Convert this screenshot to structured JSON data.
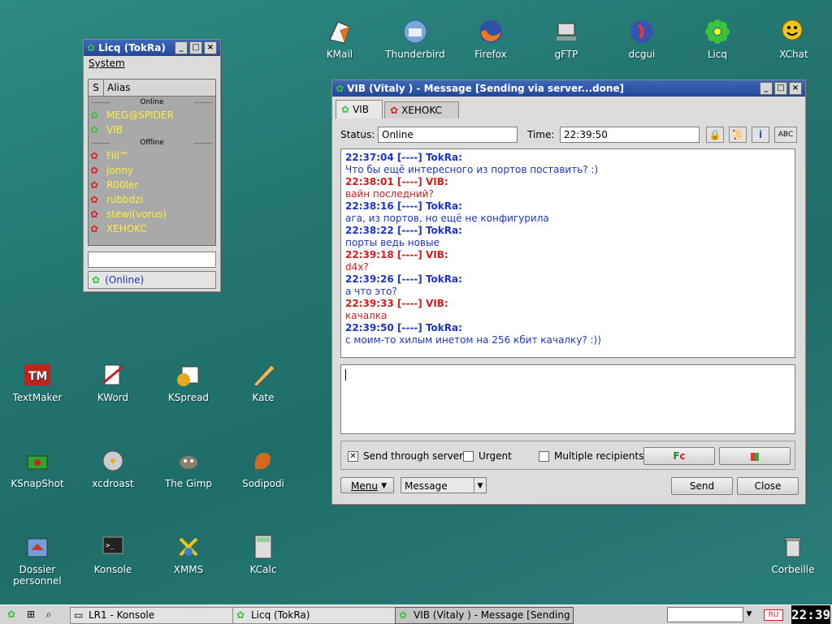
{
  "desktop_icons": [
    {
      "label": "KMail"
    },
    {
      "label": "Thunderbird"
    },
    {
      "label": "Firefox"
    },
    {
      "label": "gFTP"
    },
    {
      "label": "dcgui"
    },
    {
      "label": "Licq"
    },
    {
      "label": "XChat"
    },
    {
      "label": "TextMaker"
    },
    {
      "label": "KWord"
    },
    {
      "label": "KSpread"
    },
    {
      "label": "Kate"
    },
    {
      "label": "KSnapShot"
    },
    {
      "label": "xcdroast"
    },
    {
      "label": "The Gimp"
    },
    {
      "label": "Sodipodi"
    },
    {
      "label": "Dossier personnel"
    },
    {
      "label": "Konsole"
    },
    {
      "label": "XMMS"
    },
    {
      "label": "KCalc"
    },
    {
      "label": "Corbeille"
    }
  ],
  "licq": {
    "title": "Licq (TokRa)",
    "menu": "System",
    "col_s": "S",
    "col_alias": "Alias",
    "group_online": "Online",
    "group_offline": "Offline",
    "online": [
      "MEG@SPIDER",
      "VIB"
    ],
    "offline": [
      "Fill™",
      "jonny",
      "R00ler",
      "rubbdzi",
      "stewi(vorus)",
      "XEHOKC"
    ],
    "status": "(Online)"
  },
  "msgwin": {
    "title": "VIB (Vitaly ) - Message [Sending via server...done]",
    "tabs": [
      "VIB",
      "XEHOKC"
    ],
    "status_label": "Status:",
    "status_value": "Online",
    "time_label": "Time:",
    "time_value": "22:39:50",
    "messages": [
      {
        "head": "22:37:04 [----] TokRa:",
        "text": "Что бы ещё интересного из портов поставить? :)"
      },
      {
        "head": "22:38:01 [----] VIB:",
        "text": "вайн последний?"
      },
      {
        "head": "22:38:16 [----] TokRa:",
        "text": "ага, из портов, но ещё не конфигурила"
      },
      {
        "head": "22:38:22 [----] TokRa:",
        "text": "порты ведь новые"
      },
      {
        "head": "22:39:18 [----] VIB:",
        "text": "d4x?"
      },
      {
        "head": "22:39:26 [----] TokRa:",
        "text": "а что это?"
      },
      {
        "head": "22:39:33 [----] VIB:",
        "text": "качалка"
      },
      {
        "head": "22:39:50 [----] TokRa:",
        "text": "с моим-то хилым инетом на 256 кбит качалку? :))"
      }
    ],
    "send_through_server": "Send through server",
    "urgent": "Urgent",
    "multiple": "Multiple recipients",
    "menu_btn": "Menu",
    "type_select": "Message",
    "send_btn": "Send",
    "close_btn": "Close"
  },
  "taskbar": {
    "tasks": [
      "LR1 - Konsole",
      "Licq (TokRa)",
      "VIB (Vitaly ) - Message [Sending"
    ],
    "clock": "22:39",
    "lang": "RU"
  },
  "colors": {
    "me": "#1d35c5",
    "peer": "#d41c1c",
    "contact_text": "#ffef3b"
  }
}
